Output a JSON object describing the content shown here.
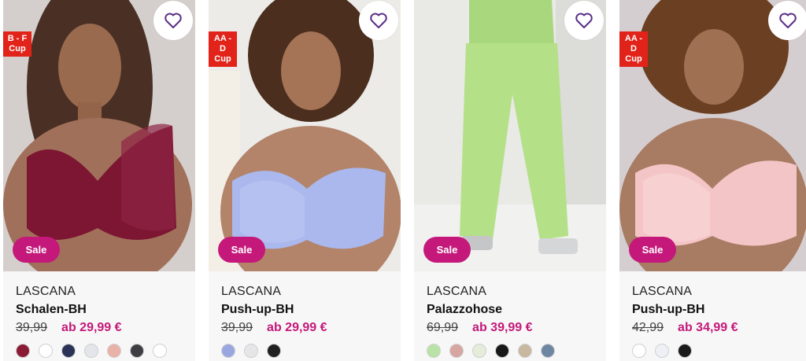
{
  "products": [
    {
      "brand": "LASCANA",
      "title": "Schalen-BH",
      "old_price": "39,99",
      "new_price": "ab 29,99 €",
      "cup_badge": "B - F\nCup",
      "sale_label": "Sale",
      "wishlist_icon": "heart-outline-icon",
      "image": "woman-in-burgundy-bra",
      "swatches": [
        "#8b1a35",
        "#ffffff",
        "#2a3357",
        "#e4e5ea",
        "#eab1a8",
        "#3f3f43",
        "#ffffff"
      ]
    },
    {
      "brand": "LASCANA",
      "title": "Push-up-BH",
      "old_price": "39,99",
      "new_price": "ab 29,99 €",
      "cup_badge": "AA - D\nCup",
      "sale_label": "Sale",
      "wishlist_icon": "heart-outline-icon",
      "image": "woman-in-lavender-lace-bra",
      "swatches": [
        "#9aa6e0",
        "#e6e6e8",
        "#202020"
      ]
    },
    {
      "brand": "LASCANA",
      "title": "Palazzohose",
      "old_price": "69,99",
      "new_price": "ab 39,99 €",
      "cup_badge": "",
      "sale_label": "Sale",
      "wishlist_icon": "heart-outline-icon",
      "image": "green-wide-leg-trousers",
      "swatches": [
        "#b9e3a6",
        "#d7a6a0",
        "#e5ecd9",
        "#181818",
        "#c9b8a0",
        "#6f86a3"
      ]
    },
    {
      "brand": "LASCANA",
      "title": "Push-up-BH",
      "old_price": "42,99",
      "new_price": "ab 34,99 €",
      "cup_badge": "AA - D\nCup",
      "sale_label": "Sale",
      "wishlist_icon": "heart-outline-icon",
      "image": "woman-in-pink-lace-bra",
      "swatches": [
        "#ffffff",
        "#eef0f6",
        "#1a1a1a"
      ]
    }
  ],
  "colors": {
    "accent": "#c4197a",
    "badge_red": "#e2231a",
    "heart": "#5a2d86"
  }
}
